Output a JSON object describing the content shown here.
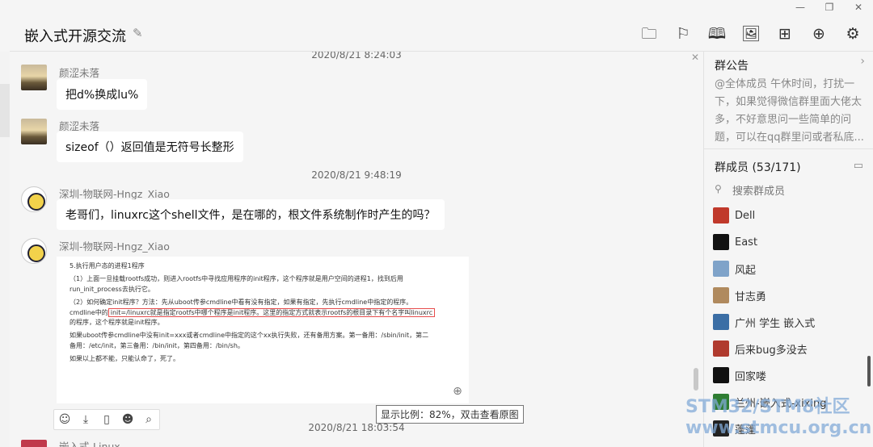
{
  "window": {
    "min_glyph": "—",
    "restore_glyph": "❐",
    "close_glyph": "✕"
  },
  "header": {
    "title": "嵌入式开源交流",
    "toolbar_icons": [
      "folder-icon",
      "flag-icon",
      "book-icon",
      "image-icon",
      "apps-grid-icon",
      "add-box-icon",
      "gear-icon"
    ]
  },
  "chat": {
    "messages": [
      {
        "timestamp": "2020/8/21 8:24:03",
        "sender": "颜涩未落",
        "text": "把d%换成lu%"
      },
      {
        "sender": "颜涩未落",
        "text": "sizeof（）返回值是无符号长整形"
      },
      {
        "timestamp": "2020/8/21 9:48:19",
        "sender": "深圳-物联网-Hngz_Xiao",
        "text": "老哥们，linuxrc这个shell文件，是在哪的，根文件系统制作时产生的吗？"
      },
      {
        "sender": "深圳-物联网-Hngz_Xiao"
      },
      {
        "timestamp": "2020/8/21 18:03:54",
        "sender": "嵌入式-Linux"
      }
    ],
    "image_text": {
      "l1": "5.执行用户态的进程1程序",
      "l2": "（1）上面一旦挂载rootfs成功，则进入rootfs中寻找应用程序的init程序，这个程序就是用户空间的进程1，找到后用",
      "l3": "run_init_process去执行它。",
      "l4": "（2）如何确定init程序？方法：先从uboot传参cmdline中看有没有指定，如果有指定，先执行cmdline中指定的程序。",
      "l5a": "cmdline中的",
      "l5b": "init=/linuxrc就是指定rootfs中哪个程序是init程序。这里的指定方式就表示rootfs的根目录下有个名字叫linuxrc",
      "l6": "的程序，这个程序就是init程序。",
      "l7": "如果uboot传参cmdline中没有init=xxx或者cmdline中指定的这个xx执行失败，还有备用方案。第一备用：/sbin/init，第二",
      "l8": "备用：/etc/init，第三备用：/bin/init，第四备用：/bin/sh。",
      "l9": "如果以上都不能，只能认命了，死了。"
    },
    "image_tooltip": "显示比例：82%，双击查看原图"
  },
  "panel": {
    "notice_title": "群公告",
    "notice_text": "@全体成员 午休时间，打扰一下，如果觉得微信群里面大佬太多，不好意思问一些简单的问题，可以在qq群里问或者私底...",
    "members_title": "群成员 (53/171)",
    "search_placeholder": "搜索群成员",
    "members": [
      {
        "name": "Dell",
        "color": "#c0392b"
      },
      {
        "name": "East",
        "color": "#111111"
      },
      {
        "name": "风起",
        "color": "#7fa3c9"
      },
      {
        "name": "甘志勇",
        "color": "#b08a5e"
      },
      {
        "name": "广州 学生 嵌入式",
        "color": "#3b6ea5"
      },
      {
        "name": "后来bug多没去",
        "color": "#b03a2e"
      },
      {
        "name": "回家喽",
        "color": "#111111"
      },
      {
        "name": "兰州-嵌入式-xixing",
        "color": "#2e7d32"
      },
      {
        "name": "蓬蓬",
        "color": "#222222"
      }
    ]
  },
  "watermark": {
    "line1": "STM32/STM8社区",
    "line2": "www.stmcu.org.cn"
  }
}
